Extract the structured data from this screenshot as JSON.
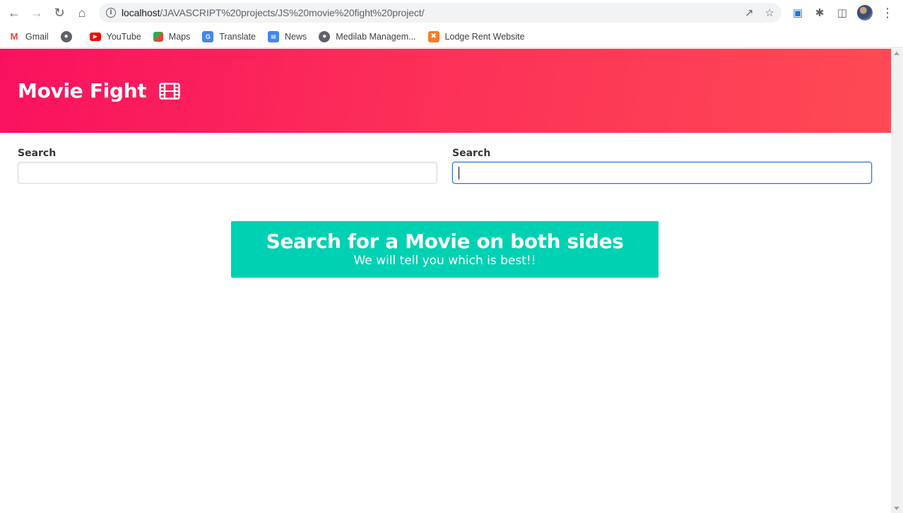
{
  "browser": {
    "url_host": "localhost",
    "url_path": "/JAVASCRIPT%20projects/JS%20movie%20fight%20project/",
    "bookmarks": [
      {
        "label": "Gmail",
        "icon": "gmail-icon"
      },
      {
        "label": "",
        "icon": "globe-icon"
      },
      {
        "label": "YouTube",
        "icon": "youtube-icon"
      },
      {
        "label": "Maps",
        "icon": "maps-icon"
      },
      {
        "label": "Translate",
        "icon": "translate-icon"
      },
      {
        "label": "News",
        "icon": "news-icon"
      },
      {
        "label": "Medilab Managem...",
        "icon": "globe-icon"
      },
      {
        "label": "Lodge Rent Website",
        "icon": "xampp-icon"
      }
    ]
  },
  "hero": {
    "title": "Movie Fight",
    "icon": "film-icon"
  },
  "search_left": {
    "label": "Search",
    "value": "",
    "placeholder": ""
  },
  "search_right": {
    "label": "Search",
    "value": "",
    "placeholder": ""
  },
  "notice": {
    "title": "Search for a Movie on both sides",
    "subtitle": "We will tell you which is best!!"
  },
  "colors": {
    "hero_start": "#f9115f",
    "hero_end": "#fe4a54",
    "notice_bg": "#00d1b2",
    "focus_border": "#3273dc"
  }
}
